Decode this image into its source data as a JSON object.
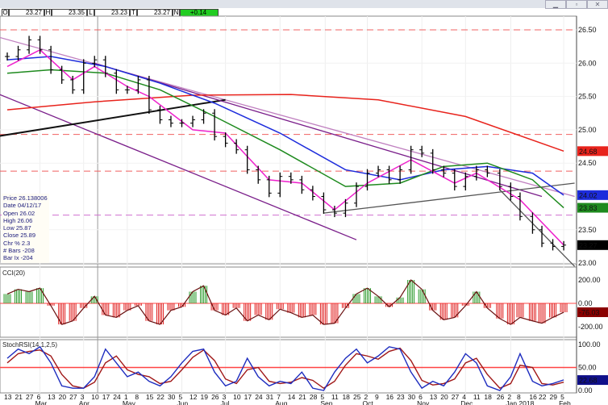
{
  "window": {
    "buttons": [
      "minimize",
      "restore",
      "close"
    ]
  },
  "quote_bar": [
    {
      "key": "O",
      "value": "23.27"
    },
    {
      "key": "H",
      "value": "23.35"
    },
    {
      "key": "L",
      "value": "23.23"
    },
    {
      "key": "T",
      "value": "23.27"
    },
    {
      "key": "N",
      "value": "+0.14",
      "color": "#22cc22"
    }
  ],
  "info_box": [
    "Price  26.138006",
    "Date  04/12/17",
    "Open  26.02",
    "High  26.06",
    "Low  25.87",
    "Close  25.89",
    "Chr %  2.3",
    "# Bars  -208",
    "Bar Ix  -204"
  ],
  "chart_data": [
    {
      "type": "ohlc",
      "panel": "price",
      "ylim": [
        23.0,
        26.6
      ],
      "y_ticks": [
        "26.50",
        "26.00",
        "25.50",
        "25.00",
        "24.50",
        "23.50",
        "23.00"
      ],
      "weeks": [
        "2017-02-13",
        "2017-02-20",
        "2017-02-27",
        "2017-03-06",
        "2017-03-13",
        "2017-03-20",
        "2017-03-27",
        "2017-04-03",
        "2017-04-10",
        "2017-04-17",
        "2017-04-24",
        "2017-05-01",
        "2017-05-08",
        "2017-05-15",
        "2017-05-22",
        "2017-05-29",
        "2017-06-05",
        "2017-06-12",
        "2017-06-19",
        "2017-06-26",
        "2017-07-03",
        "2017-07-10",
        "2017-07-17",
        "2017-07-24",
        "2017-07-31",
        "2017-08-07",
        "2017-08-14",
        "2017-08-21",
        "2017-08-28",
        "2017-09-04",
        "2017-09-11",
        "2017-09-18",
        "2017-09-25",
        "2017-10-02",
        "2017-10-09",
        "2017-10-16",
        "2017-10-23",
        "2017-10-30",
        "2017-11-06",
        "2017-11-13",
        "2017-11-20",
        "2017-11-27",
        "2017-12-04",
        "2017-12-11",
        "2017-12-18",
        "2017-12-26",
        "2018-01-02",
        "2018-01-08",
        "2018-01-16",
        "2018-01-22",
        "2018-01-29",
        "2018-02-05"
      ],
      "close": [
        26.1,
        26.2,
        26.35,
        26.2,
        25.9,
        25.75,
        25.6,
        26.0,
        26.05,
        25.85,
        25.6,
        25.6,
        25.75,
        25.3,
        25.15,
        25.1,
        25.1,
        25.15,
        25.25,
        24.9,
        24.8,
        24.7,
        24.4,
        24.25,
        24.05,
        24.3,
        24.25,
        24.1,
        24.0,
        23.8,
        23.75,
        23.9,
        24.15,
        24.35,
        24.4,
        24.25,
        24.4,
        24.7,
        24.65,
        24.4,
        24.35,
        24.15,
        24.3,
        24.4,
        24.35,
        24.15,
        24.0,
        23.7,
        23.5,
        23.3,
        23.25,
        23.27
      ],
      "moving_averages": [
        {
          "color": "#e8231c",
          "last": "24.68",
          "dates": [
            "2017-02-13",
            "2017-04-10",
            "2017-06-12",
            "2017-08-14",
            "2017-10-09",
            "2017-12-04",
            "2018-02-05"
          ],
          "values": [
            25.3,
            25.42,
            25.52,
            25.53,
            25.45,
            25.2,
            24.68
          ]
        },
        {
          "color": "#1d2cdc",
          "last": "24.02",
          "dates": [
            "2017-02-13",
            "2017-03-13",
            "2017-04-17",
            "2017-05-22",
            "2017-06-26",
            "2017-08-07",
            "2017-09-18",
            "2017-10-23",
            "2017-11-20",
            "2017-12-18",
            "2018-01-16",
            "2018-02-05"
          ],
          "values": [
            26.05,
            26.1,
            25.95,
            25.7,
            25.4,
            24.95,
            24.4,
            24.25,
            24.4,
            24.45,
            24.35,
            24.02
          ]
        },
        {
          "color": "#1e8a1e",
          "last": "23.83",
          "dates": [
            "2017-02-13",
            "2017-03-13",
            "2017-04-17",
            "2017-05-22",
            "2017-06-26",
            "2017-08-07",
            "2017-09-18",
            "2017-10-23",
            "2017-11-20",
            "2017-12-18",
            "2018-01-16",
            "2018-02-05"
          ],
          "values": [
            25.85,
            25.9,
            25.85,
            25.6,
            25.2,
            24.7,
            24.15,
            24.2,
            24.45,
            24.5,
            24.25,
            23.83
          ]
        },
        {
          "color": "#ee22cc",
          "last": "23.27",
          "dates": [
            "2017-02-13",
            "2017-03-06",
            "2017-03-27",
            "2017-04-10",
            "2017-05-01",
            "2017-05-15",
            "2017-06-12",
            "2017-07-03",
            "2017-07-31",
            "2017-08-21",
            "2017-09-11",
            "2017-10-02",
            "2017-10-30",
            "2017-11-27",
            "2017-12-11",
            "2018-01-08",
            "2018-02-05"
          ],
          "values": [
            25.95,
            26.2,
            25.75,
            25.95,
            25.65,
            25.5,
            25.0,
            24.95,
            24.25,
            24.2,
            23.8,
            24.2,
            24.55,
            24.2,
            24.35,
            23.95,
            23.27
          ]
        }
      ],
      "last_close_label": "23.27",
      "horizontal_lines": [
        26.5,
        24.93,
        24.38,
        23.72
      ],
      "trendlines": [
        {
          "from": [
            "2017-02-06",
            26.4
          ],
          "to": [
            "2018-02-12",
            24.0
          ],
          "color": "#c080c0"
        },
        {
          "from": [
            "2017-02-06",
            25.55
          ],
          "to": [
            "2017-09-25",
            23.35
          ],
          "color": "#7a1e8a"
        },
        {
          "from": [
            "2017-02-06",
            24.9
          ],
          "to": [
            "2017-07-03",
            25.45
          ],
          "color": "#111111"
        },
        {
          "from": [
            "2017-04-10",
            26.0
          ],
          "to": [
            "2018-01-22",
            24.0
          ],
          "color": "#7a1e8a"
        },
        {
          "from": [
            "2017-09-04",
            23.75
          ],
          "to": [
            "2018-02-12",
            24.2
          ],
          "color": "#555555"
        },
        {
          "from": [
            "2017-12-26",
            24.1
          ],
          "to": [
            "2018-02-12",
            22.95
          ],
          "color": "#555555"
        }
      ]
    },
    {
      "type": "bar",
      "panel": "cci",
      "title": "CCI(20)",
      "ylim": [
        -300,
        300
      ],
      "y_ticks": [
        "200.00",
        "0.00",
        "-200.00"
      ],
      "last": "-76.03",
      "values": [
        80,
        120,
        100,
        130,
        -20,
        -180,
        -150,
        -40,
        60,
        -100,
        -120,
        -60,
        -20,
        -150,
        -180,
        -60,
        -30,
        100,
        150,
        -60,
        -100,
        -40,
        -150,
        -100,
        -140,
        -50,
        -80,
        -120,
        -100,
        -180,
        -170,
        -40,
        80,
        130,
        60,
        -30,
        50,
        200,
        120,
        -60,
        -140,
        -120,
        -20,
        100,
        -40,
        -130,
        -180,
        -120,
        -150,
        -170,
        -120,
        -76
      ]
    },
    {
      "type": "line",
      "panel": "stochrsi",
      "title": "StochRSI(14,1,2,5)",
      "ylim": [
        0,
        100
      ],
      "y_ticks": [
        "100.00",
        "50.00",
        "0.00"
      ],
      "last": "22.68",
      "series": [
        {
          "color": "#1d2cbf",
          "values": [
            70,
            90,
            80,
            95,
            60,
            10,
            5,
            5,
            30,
            90,
            60,
            30,
            40,
            20,
            10,
            30,
            60,
            85,
            90,
            40,
            10,
            20,
            70,
            30,
            10,
            20,
            15,
            40,
            5,
            0,
            40,
            70,
            90,
            60,
            75,
            95,
            90,
            40,
            5,
            20,
            10,
            40,
            80,
            60,
            10,
            0,
            30,
            80,
            20,
            10,
            15,
            23
          ]
        },
        {
          "color": "#a01818",
          "values": [
            60,
            80,
            85,
            88,
            75,
            35,
            10,
            5,
            18,
            60,
            75,
            45,
            35,
            30,
            15,
            20,
            45,
            72,
            88,
            65,
            25,
            15,
            45,
            50,
            20,
            15,
            18,
            28,
            22,
            5,
            20,
            55,
            80,
            75,
            68,
            85,
            92,
            65,
            22,
            12,
            15,
            25,
            60,
            70,
            35,
            5,
            15,
            55,
            50,
            15,
            12,
            18
          ]
        }
      ]
    },
    {
      "panel": "x_axis",
      "ticks": [
        "13",
        "21",
        "27",
        "6",
        "13",
        "20",
        "27",
        "3",
        "10",
        "17",
        "24",
        "1",
        "8",
        "15",
        "22",
        "30",
        "5",
        "12",
        "19",
        "26",
        "3",
        "10",
        "17",
        "24",
        "31",
        "7",
        "14",
        "21",
        "28",
        "5",
        "11",
        "18",
        "25",
        "2",
        "9",
        "16",
        "23",
        "30",
        "6",
        "13",
        "20",
        "27",
        "4",
        "11",
        "18",
        "26",
        "2",
        "8",
        "16",
        "22",
        "29",
        "5"
      ],
      "months": [
        [
          "Mar",
          "2017-03-06"
        ],
        [
          "Apr",
          "2017-04-03"
        ],
        [
          "May",
          "2017-05-01"
        ],
        [
          "Jun",
          "2017-06-05"
        ],
        [
          "Jul",
          "2017-07-03"
        ],
        [
          "Aug",
          "2017-08-07"
        ],
        [
          "Sep",
          "2017-09-05"
        ],
        [
          "Oct",
          "2017-10-02"
        ],
        [
          "Nov",
          "2017-11-06"
        ],
        [
          "Dec",
          "2017-12-04"
        ],
        [
          "Jan 2018",
          "2018-01-02"
        ],
        [
          "Feb",
          "2018-02-05"
        ]
      ]
    }
  ]
}
